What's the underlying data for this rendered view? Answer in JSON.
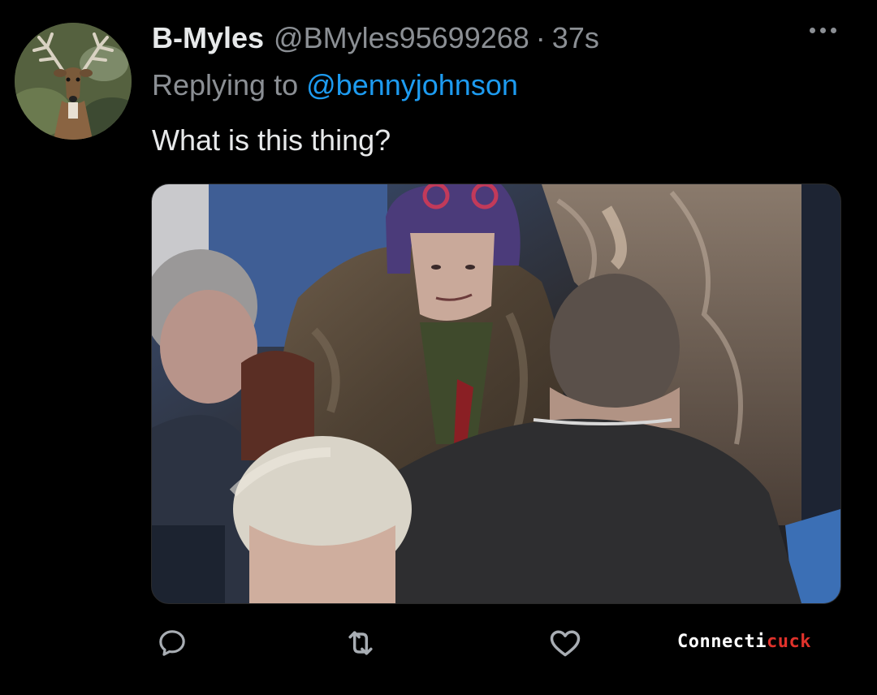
{
  "tweet": {
    "display_name": "B-Myles",
    "handle": "@BMyles95699268",
    "separator": "·",
    "time": "37s",
    "reply_prefix": "Replying to",
    "reply_target": "@bennyjohnson",
    "text": "What is this thing?",
    "avatar_icon": "deer-icon",
    "more_icon": "more-horizontal-icon"
  },
  "actions": {
    "reply_icon": "reply-icon",
    "retweet_icon": "retweet-icon",
    "like_icon": "heart-icon"
  },
  "watermark": {
    "part1": "Connecti",
    "part2": "cuck",
    "color_part1": "#ffffff",
    "color_part2": "#e0322b"
  },
  "colors": {
    "background": "#000000",
    "text_primary": "#e7e9ea",
    "text_secondary": "#8b8f94",
    "link": "#1d9bf0"
  }
}
